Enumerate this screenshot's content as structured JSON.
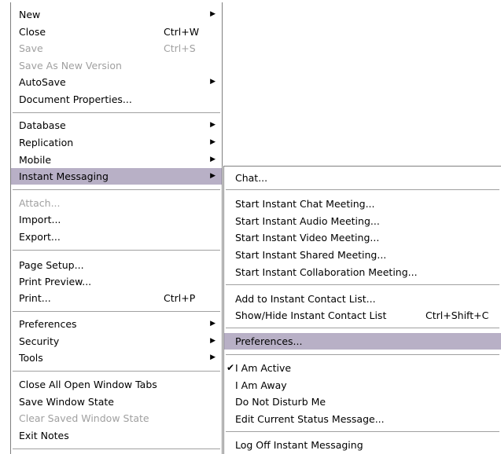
{
  "main_menu": {
    "items": [
      {
        "label": "New",
        "shortcut": "",
        "submenu": true,
        "disabled": false
      },
      {
        "label": "Close",
        "shortcut": "Ctrl+W",
        "submenu": false,
        "disabled": false
      },
      {
        "label": "Save",
        "shortcut": "Ctrl+S",
        "submenu": false,
        "disabled": true
      },
      {
        "label": "Save As New Version",
        "shortcut": "",
        "submenu": false,
        "disabled": true
      },
      {
        "label": "AutoSave",
        "shortcut": "",
        "submenu": true,
        "disabled": false
      },
      {
        "label": "Document Properties...",
        "shortcut": "",
        "submenu": false,
        "disabled": false
      },
      {
        "label": "Database",
        "shortcut": "",
        "submenu": true,
        "disabled": false
      },
      {
        "label": "Replication",
        "shortcut": "",
        "submenu": true,
        "disabled": false
      },
      {
        "label": "Mobile",
        "shortcut": "",
        "submenu": true,
        "disabled": false
      },
      {
        "label": "Instant Messaging",
        "shortcut": "",
        "submenu": true,
        "disabled": false,
        "highlighted": true
      },
      {
        "label": "Attach...",
        "shortcut": "",
        "submenu": false,
        "disabled": true
      },
      {
        "label": "Import...",
        "shortcut": "",
        "submenu": false,
        "disabled": false
      },
      {
        "label": "Export...",
        "shortcut": "",
        "submenu": false,
        "disabled": false
      },
      {
        "label": "Page Setup...",
        "shortcut": "",
        "submenu": false,
        "disabled": false
      },
      {
        "label": "Print Preview...",
        "shortcut": "",
        "submenu": false,
        "disabled": false
      },
      {
        "label": "Print...",
        "shortcut": "Ctrl+P",
        "submenu": false,
        "disabled": false
      },
      {
        "label": "Preferences",
        "shortcut": "",
        "submenu": true,
        "disabled": false
      },
      {
        "label": "Security",
        "shortcut": "",
        "submenu": true,
        "disabled": false
      },
      {
        "label": "Tools",
        "shortcut": "",
        "submenu": true,
        "disabled": false
      },
      {
        "label": "Close All Open Window Tabs",
        "shortcut": "",
        "submenu": false,
        "disabled": false
      },
      {
        "label": "Save Window State",
        "shortcut": "",
        "submenu": false,
        "disabled": false
      },
      {
        "label": "Clear Saved Window State",
        "shortcut": "",
        "submenu": false,
        "disabled": true
      },
      {
        "label": "Exit Notes",
        "shortcut": "",
        "submenu": false,
        "disabled": false
      }
    ]
  },
  "submenu": {
    "items": [
      {
        "label": "Chat...",
        "shortcut": "",
        "checked": false
      },
      {
        "label": "Start Instant Chat Meeting...",
        "shortcut": "",
        "checked": false
      },
      {
        "label": "Start Instant Audio Meeting...",
        "shortcut": "",
        "checked": false
      },
      {
        "label": "Start Instant Video Meeting...",
        "shortcut": "",
        "checked": false
      },
      {
        "label": "Start Instant Shared Meeting...",
        "shortcut": "",
        "checked": false
      },
      {
        "label": "Start Instant Collaboration Meeting...",
        "shortcut": "",
        "checked": false
      },
      {
        "label": "Add to Instant Contact List...",
        "shortcut": "",
        "checked": false
      },
      {
        "label": "Show/Hide Instant Contact List",
        "shortcut": "Ctrl+Shift+C",
        "checked": false
      },
      {
        "label": "Preferences...",
        "shortcut": "",
        "checked": false,
        "highlighted": true
      },
      {
        "label": "I Am Active",
        "shortcut": "",
        "checked": true
      },
      {
        "label": "I Am Away",
        "shortcut": "",
        "checked": false
      },
      {
        "label": "Do Not Disturb Me",
        "shortcut": "",
        "checked": false
      },
      {
        "label": "Edit Current Status Message...",
        "shortcut": "",
        "checked": false
      },
      {
        "label": "Log Off Instant Messaging",
        "shortcut": "",
        "checked": false
      }
    ]
  },
  "colors": {
    "highlight": "#b8b0c6",
    "disabled_text": "#a0a0a0",
    "border": "#7f7f7f"
  },
  "icons": {
    "submenu_arrow": "right-triangle-icon",
    "check": "checkmark-icon"
  }
}
